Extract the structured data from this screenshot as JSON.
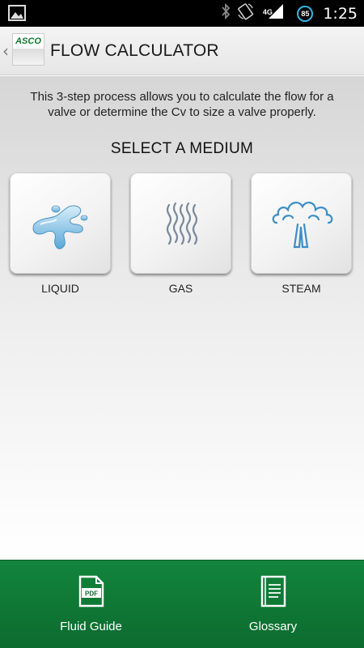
{
  "status_bar": {
    "network": "4G",
    "battery": "85",
    "time": "1:25",
    "icons": [
      "image-icon",
      "bluetooth-icon",
      "rotate-icon",
      "signal-icon",
      "battery-icon"
    ]
  },
  "action_bar": {
    "logo_text": "ASCO",
    "title": "FLOW CALCULATOR"
  },
  "content": {
    "intro": "This 3-step process allows you to calculate the flow for a valve or determine the Cv to size a valve properly.",
    "section_title": "SELECT A MEDIUM",
    "media": [
      {
        "label": "LIQUID",
        "icon": "liquid-splash-icon"
      },
      {
        "label": "GAS",
        "icon": "gas-waves-icon"
      },
      {
        "label": "STEAM",
        "icon": "steam-cloud-icon"
      }
    ]
  },
  "bottom_bar": {
    "buttons": [
      {
        "label": "Fluid Guide",
        "icon": "pdf-document-icon",
        "icon_text": "PDF"
      },
      {
        "label": "Glossary",
        "icon": "book-icon"
      }
    ]
  },
  "colors": {
    "brand_green": "#0c6b2f",
    "status_accent": "#33b5e5"
  }
}
